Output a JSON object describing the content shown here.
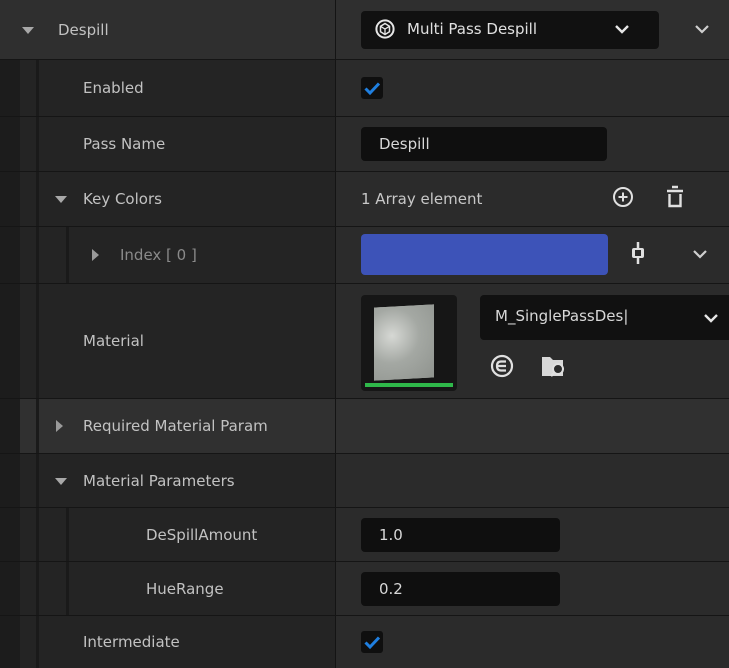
{
  "despill": {
    "label": "Despill",
    "class_dropdown_value": "Multi Pass Despill",
    "class_icon": "unreal-engine-logo-icon"
  },
  "enabled": {
    "label": "Enabled",
    "checked": true
  },
  "pass_name": {
    "label": "Pass Name",
    "value": "Despill"
  },
  "key_colors": {
    "label": "Key Colors",
    "summary": "1 Array element"
  },
  "index0": {
    "label": "Index [ 0 ]",
    "color": "#3d53b8"
  },
  "material": {
    "label": "Material",
    "asset_name": "M_SinglePassDes|"
  },
  "required_params": {
    "label": "Required Material Param"
  },
  "material_params": {
    "label": "Material Parameters"
  },
  "despill_amount": {
    "label": "DeSpillAmount",
    "value": "1.0"
  },
  "hue_range": {
    "label": "HueRange",
    "value": "0.2"
  },
  "intermediate": {
    "label": "Intermediate",
    "checked": true
  },
  "colors": {
    "accent": "#1f7fe0",
    "panel": "#242424",
    "value_bg": "#2b2b2b",
    "input_bg": "#0f0f0f",
    "swatch": "#3d53b8",
    "asset_bar": "#2fb84a"
  }
}
